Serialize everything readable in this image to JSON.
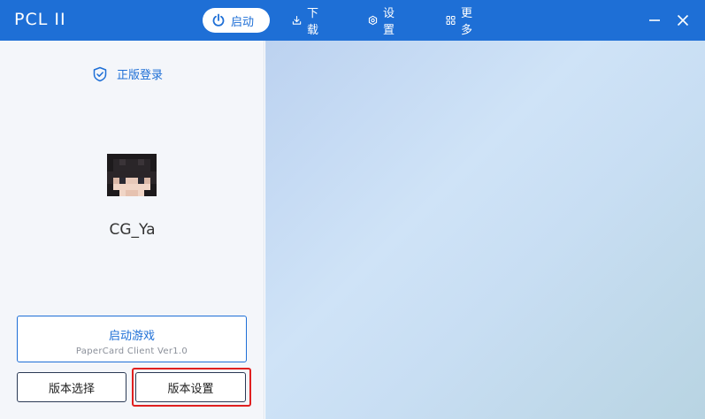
{
  "app": {
    "title": "PCL II"
  },
  "nav": {
    "items": [
      {
        "label": "启动",
        "icon": "power-icon",
        "active": true
      },
      {
        "label": "下载",
        "icon": "download-icon",
        "active": false
      },
      {
        "label": "设置",
        "icon": "gear-icon",
        "active": false
      },
      {
        "label": "更多",
        "icon": "grid-icon",
        "active": false
      }
    ]
  },
  "window": {
    "minimize_icon": "minimize-icon",
    "close_icon": "close-icon"
  },
  "login": {
    "mode_label": "正版登录",
    "icon": "shield-check-icon"
  },
  "profile": {
    "username": "CG_Ya",
    "avatar": "player-head-avatar"
  },
  "launch": {
    "title": "启动游戏",
    "subtitle": "PaperCard Client Ver1.0"
  },
  "buttons": {
    "version_select": "版本选择",
    "version_settings": "版本设置"
  },
  "colors": {
    "accent": "#1e6fd6",
    "highlight": "#e02020",
    "titlebar": "#1e6fd6"
  }
}
